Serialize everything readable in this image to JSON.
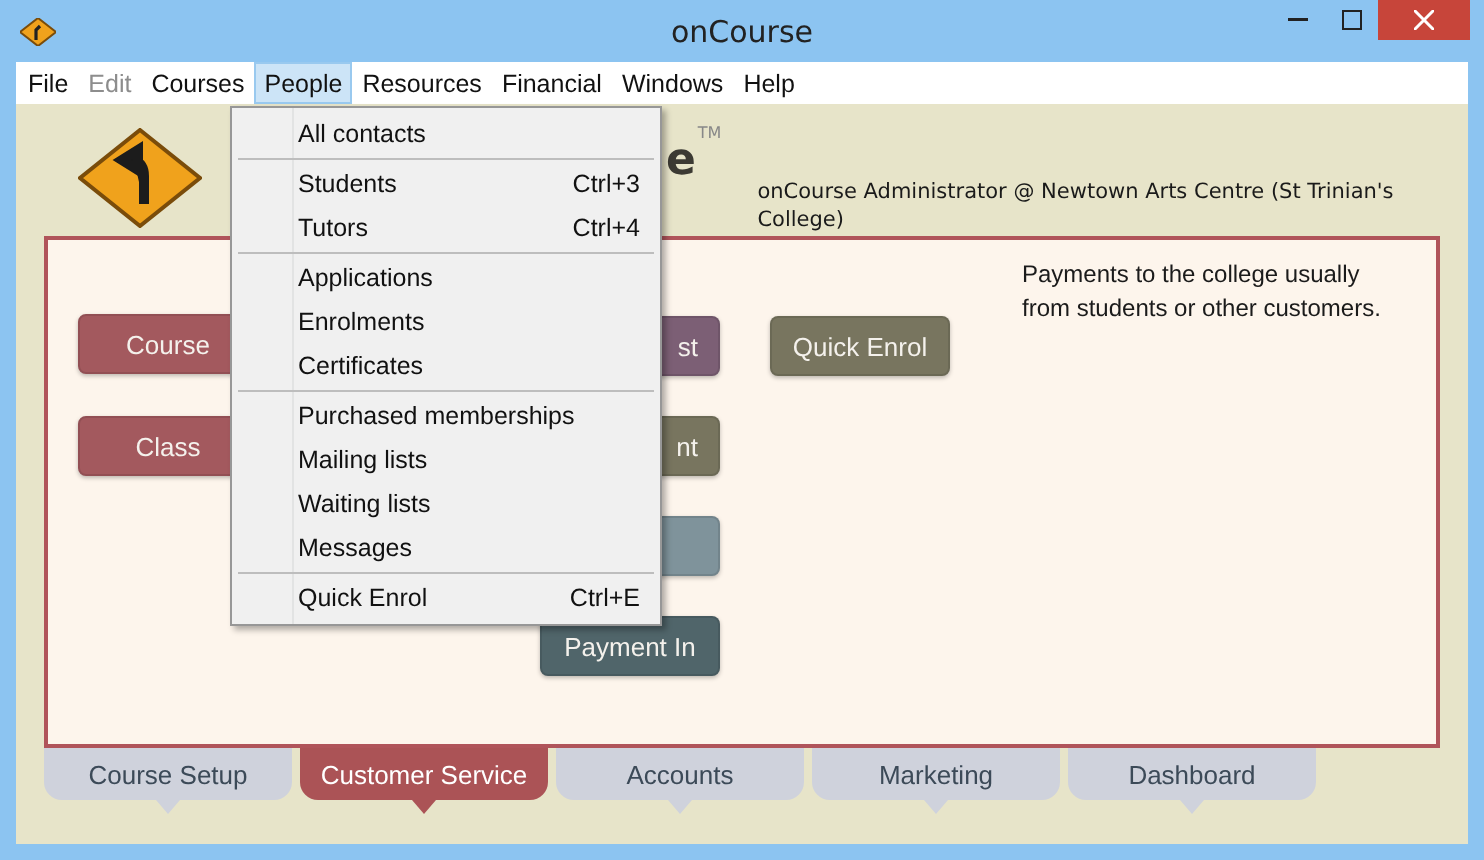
{
  "window": {
    "title": "onCourse"
  },
  "menu_bar": [
    {
      "label": "File",
      "disabled": false,
      "selected": false
    },
    {
      "label": "Edit",
      "disabled": true,
      "selected": false
    },
    {
      "label": "Courses",
      "disabled": false,
      "selected": false
    },
    {
      "label": "People",
      "disabled": false,
      "selected": true
    },
    {
      "label": "Resources",
      "disabled": false,
      "selected": false
    },
    {
      "label": "Financial",
      "disabled": false,
      "selected": false
    },
    {
      "label": "Windows",
      "disabled": false,
      "selected": false
    },
    {
      "label": "Help",
      "disabled": false,
      "selected": false
    }
  ],
  "people_menu": [
    [
      {
        "label": "All contacts"
      }
    ],
    [
      {
        "label": "Students",
        "shortcut": "Ctrl+3"
      },
      {
        "label": "Tutors",
        "shortcut": "Ctrl+4"
      }
    ],
    [
      {
        "label": "Applications"
      },
      {
        "label": "Enrolments"
      },
      {
        "label": "Certificates"
      }
    ],
    [
      {
        "label": "Purchased memberships"
      },
      {
        "label": "Mailing lists"
      },
      {
        "label": "Waiting lists"
      },
      {
        "label": "Messages"
      }
    ],
    [
      {
        "label": "Quick Enrol",
        "shortcut": "Ctrl+E"
      }
    ]
  ],
  "header": {
    "logo_text": "e",
    "trademark": "TM",
    "user_info": "onCourse Administrator @ Newtown Arts Centre (St Trinian's College)"
  },
  "buttons": [
    {
      "label": "Course",
      "color": "#a3595e"
    },
    {
      "label": "Class",
      "color": "#a3595e"
    },
    {
      "label": "st",
      "color": "#7c5f75"
    },
    {
      "label": "nt",
      "color": "#78755f"
    },
    {
      "color": "#7f939b"
    },
    {
      "label": "Payment In",
      "color": "#50656a"
    },
    {
      "label": "Quick Enrol",
      "color": "#78755f"
    }
  ],
  "description": "Payments to the college usually from students or other customers.",
  "tabs": [
    {
      "label": "Course Setup",
      "selected": false
    },
    {
      "label": "Customer Service",
      "selected": true
    },
    {
      "label": "Accounts",
      "selected": false
    },
    {
      "label": "Marketing",
      "selected": false
    },
    {
      "label": "Dashboard",
      "selected": false
    }
  ]
}
